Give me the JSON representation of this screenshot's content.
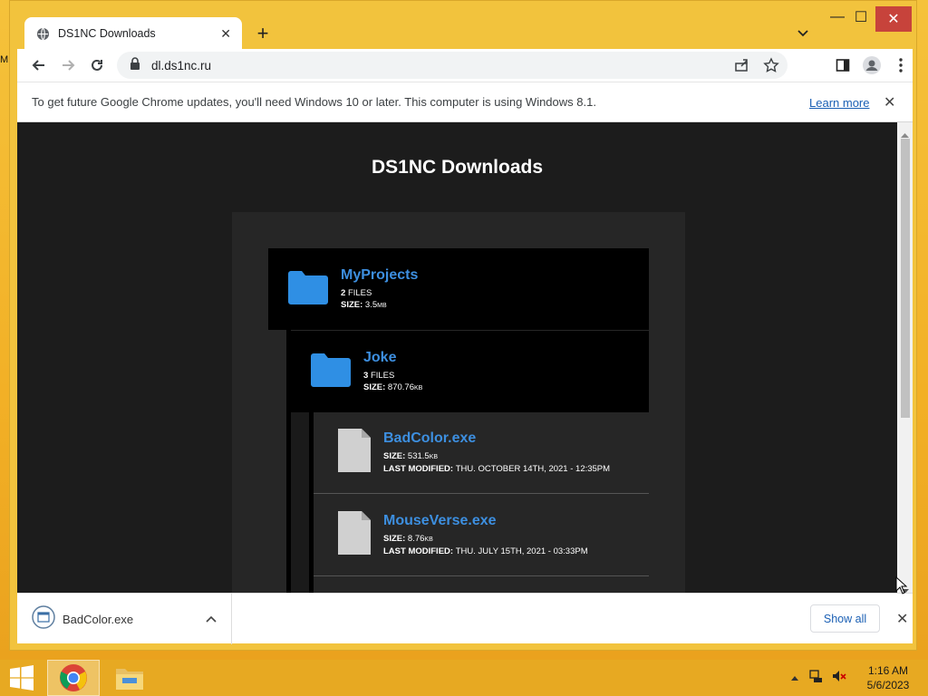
{
  "desktop": {
    "glyph": "M"
  },
  "browser": {
    "tab": {
      "title": "DS1NC Downloads",
      "close": "✕"
    },
    "new_tab": "+",
    "window_controls": {
      "minimize": "—",
      "maximize": "☐",
      "close": "✕"
    },
    "address": "dl.ds1nc.ru",
    "infobar": {
      "message": "To get future Google Chrome updates, you'll need Windows 10 or later. This computer is using Windows 8.1.",
      "link": "Learn more",
      "close": "✕"
    }
  },
  "page": {
    "title": "DS1NC Downloads",
    "folders": [
      {
        "name": "MyProjects",
        "files_count": "2",
        "files_label": "FILES",
        "size_label": "SIZE:",
        "size_value": "3.5",
        "size_unit": "MB"
      },
      {
        "name": "Joke",
        "files_count": "3",
        "files_label": "FILES",
        "size_label": "SIZE:",
        "size_value": "870.76",
        "size_unit": "KB"
      }
    ],
    "files": [
      {
        "name": "BadColor.exe",
        "size_label": "SIZE:",
        "size_value": "531.5",
        "size_unit": "KB",
        "modified_label": "LAST MODIFIED:",
        "modified_value": "THU. OCTOBER 14TH, 2021 - 12:35PM"
      },
      {
        "name": "MouseVerse.exe",
        "size_label": "SIZE:",
        "size_value": "8.76",
        "size_unit": "KB",
        "modified_label": "LAST MODIFIED:",
        "modified_value": "THU. JULY 15TH, 2021 - 03:33PM"
      }
    ]
  },
  "download_shelf": {
    "item": "BadColor.exe",
    "show_all": "Show all",
    "close": "✕"
  },
  "taskbar": {
    "time": "1:16 AM",
    "date": "5/6/2023"
  },
  "colors": {
    "link_blue": "#3d8fe0",
    "folder_blue": "#2f8fe4",
    "page_bg": "#1c1c1c",
    "taskbar": "#e7a922"
  }
}
